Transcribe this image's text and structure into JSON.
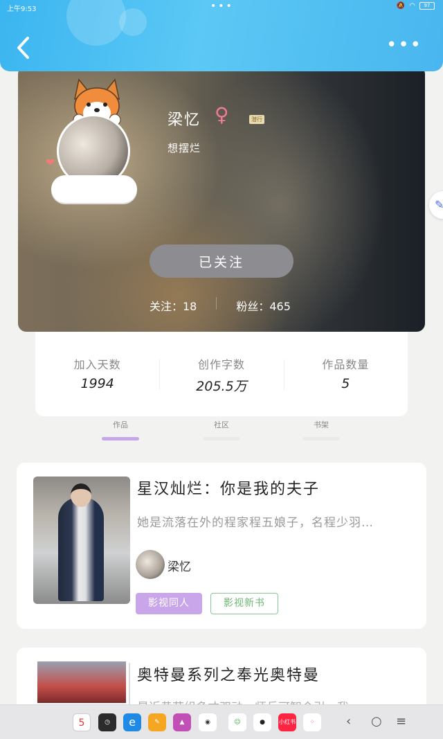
{
  "status_bar": {
    "time": "上午9:53",
    "battery": "97"
  },
  "header": {
    "back_label": "‹",
    "more_label": "•••"
  },
  "profile": {
    "name": "梁忆",
    "gender_symbol": "♀",
    "tag": "潜行",
    "signature": "想摆烂",
    "follow_button": "已关注",
    "following_label": "关注：18",
    "fans_label": "粉丝：465"
  },
  "stats": [
    {
      "label": "加入天数",
      "value": "1994"
    },
    {
      "label": "创作字数",
      "value": "205.5万"
    },
    {
      "label": "作品数量",
      "value": "5"
    }
  ],
  "tabs": [
    {
      "label": "作品",
      "active": true
    },
    {
      "label": "社区",
      "active": false
    },
    {
      "label": "书架",
      "active": false
    }
  ],
  "works": [
    {
      "title": "星汉灿烂：你是我的夫子",
      "description": "她是流落在外的程家程五娘子，名程少羽…",
      "author": "梁忆",
      "tags": [
        "影视同人",
        "影视新书"
      ]
    },
    {
      "title": "奥特曼系列之奉光奥特曼",
      "description": "最近黄苏组多才双动，师兵可智会引，我…"
    }
  ],
  "dock": {
    "apps": [
      {
        "name": "calendar",
        "label": "5",
        "color": "#ffffff"
      },
      {
        "name": "clock",
        "label": "",
        "color": "#2b2b2b"
      },
      {
        "name": "browser",
        "label": "e",
        "color": "#1e8ae6"
      },
      {
        "name": "notes",
        "label": "",
        "color": "#f5a623"
      },
      {
        "name": "gallery",
        "label": "",
        "color": "#c24fb5"
      },
      {
        "name": "camera",
        "label": "",
        "color": "#ffffff"
      },
      {
        "name": "chat",
        "label": "",
        "color": "#ffffff"
      },
      {
        "name": "paw",
        "label": "",
        "color": "#ffffff"
      },
      {
        "name": "xiaohongshu",
        "label": "小红书",
        "color": "#ff2442"
      },
      {
        "name": "app-drawer",
        "label": "",
        "color": "#ffffff"
      }
    ],
    "nav": {
      "back": "‹",
      "home": "○",
      "menu": "≡"
    }
  }
}
